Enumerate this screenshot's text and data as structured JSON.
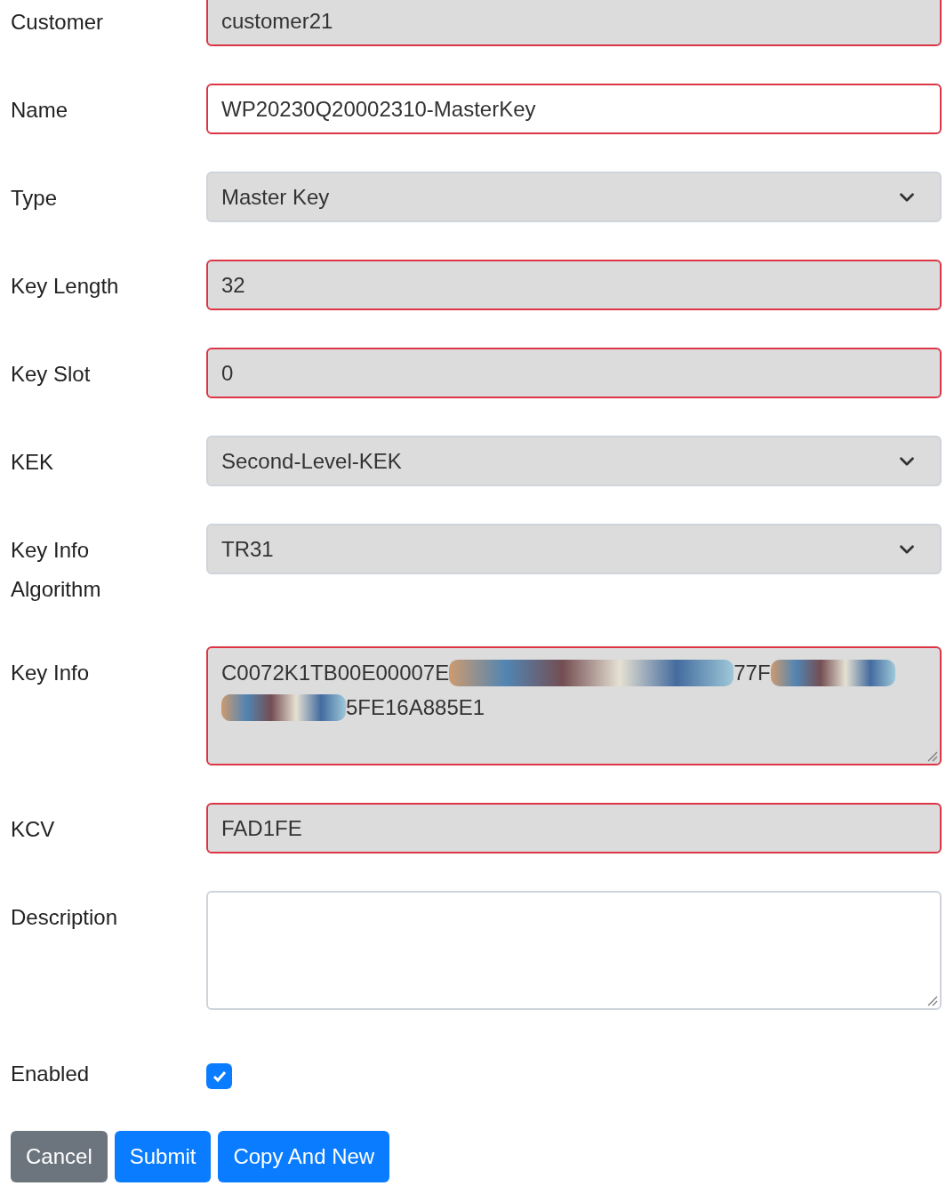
{
  "fields": [
    {
      "label": "Customer",
      "kind": "input",
      "value": "customer21",
      "disabled": true,
      "invalid": true
    },
    {
      "label": "Name",
      "kind": "input",
      "value": "WP20230Q20002310-MasterKey",
      "disabled": false,
      "invalid": true
    },
    {
      "label": "Type",
      "kind": "select",
      "value": "Master Key",
      "disabled": true,
      "invalid": false
    },
    {
      "label": "Key Length",
      "kind": "input",
      "value": "32",
      "disabled": true,
      "invalid": true
    },
    {
      "label": "Key Slot",
      "kind": "input",
      "value": "0",
      "disabled": true,
      "invalid": true
    },
    {
      "label": "KEK",
      "kind": "select",
      "value": "Second-Level-KEK",
      "disabled": true,
      "invalid": false
    },
    {
      "label": "Key Info Algorithm",
      "kind": "select",
      "value": "TR31",
      "disabled": true,
      "invalid": false
    },
    {
      "label": "Key Info",
      "kind": "textarea",
      "lines": [
        [
          {
            "kind": "text",
            "text": "C0072K1TB00E00007E"
          },
          {
            "kind": "redacted"
          },
          {
            "kind": "text",
            "text": "77F"
          },
          {
            "kind": "redacted"
          }
        ],
        [
          {
            "kind": "redacted"
          },
          {
            "kind": "text",
            "text": "5FE16A885E1"
          }
        ]
      ],
      "disabled": true,
      "invalid": true
    },
    {
      "label": "KCV",
      "kind": "input",
      "value": "FAD1FE",
      "disabled": true,
      "invalid": true
    },
    {
      "label": "Description",
      "kind": "textarea",
      "disabled": false,
      "invalid": false
    },
    {
      "label": "Enabled",
      "kind": "checkbox",
      "checked": true
    }
  ],
  "buttons": [
    {
      "label": "Cancel",
      "kind": "secondary"
    },
    {
      "label": "Submit",
      "kind": "primary"
    },
    {
      "label": "Copy And New",
      "kind": "primary"
    }
  ]
}
